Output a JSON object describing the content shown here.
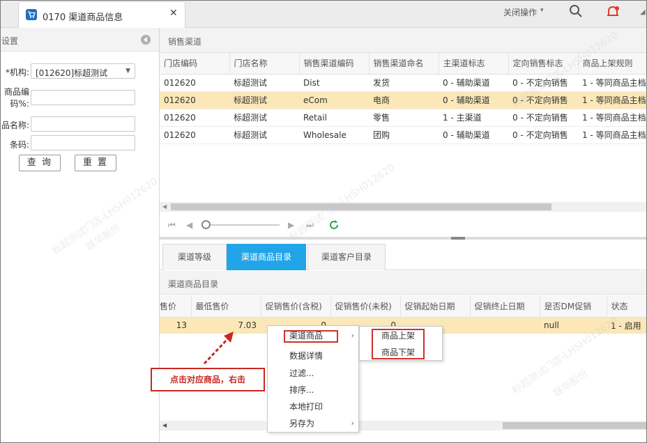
{
  "window": {
    "tab_title": "0170 渠道商品信息",
    "close_symbol": "✕",
    "close_ops_label": "关闭操作"
  },
  "left_panel": {
    "title": "设置",
    "org_label": "*机构:",
    "org_value": "[012620]标超测试",
    "code_label_1": "商品编",
    "code_label_2": "码%:",
    "name_label": "品名称:",
    "barcode_label": "条码:",
    "query_button": "查 询",
    "reset_button": "重 置"
  },
  "top_grid": {
    "title": "销售渠道",
    "columns": [
      "门店编码",
      "门店名称",
      "销售渠道编码",
      "销售渠道命名",
      "主渠道标志",
      "定向销售标志",
      "商品上架规则"
    ],
    "rows": [
      [
        "012620",
        "标超测试",
        "Dist",
        "发货",
        "0 - 辅助渠道",
        "0 - 不定向销售",
        "1 - 等同商品主档"
      ],
      [
        "012620",
        "标超测试",
        "eCom",
        "电商",
        "0 - 辅助渠道",
        "0 - 不定向销售",
        "1 - 等同商品主档"
      ],
      [
        "012620",
        "标超测试",
        "Retail",
        "零售",
        "1 - 主渠道",
        "0 - 不定向销售",
        "1 - 等同商品主档"
      ],
      [
        "012620",
        "标超测试",
        "Wholesale",
        "团购",
        "0 - 辅助渠道",
        "0 - 不定向销售",
        "1 - 等同商品主档"
      ]
    ],
    "selected_row": 1
  },
  "bottom_tabs": [
    "渠道等级",
    "渠道商品目录",
    "渠道客户目录"
  ],
  "active_bottom_tab": 1,
  "bottom_grid": {
    "title": "渠道商品目录",
    "columns": [
      "售价",
      "最低售价",
      "促销售价(含税)",
      "促销售价(未税)",
      "促销起始日期",
      "促销终止日期",
      "是否DM促销",
      "状态"
    ],
    "row": [
      "13",
      "7.03",
      "0",
      "0",
      "",
      "",
      "null",
      "1 - 启用"
    ]
  },
  "context_menu": {
    "items": [
      "渠道商品",
      "数据详情",
      "过滤...",
      "排序...",
      "本地打印",
      "另存为"
    ],
    "submenu": [
      "商品上架",
      "商品下架"
    ]
  },
  "annotation": {
    "text": "点击对应商品，右击"
  },
  "watermark": {
    "line1": "标超测试门店-LHSH012620",
    "line2": "联华股份"
  },
  "colors": {
    "accent_tab": "#21a5e8",
    "selected_row": "#fbe7b8",
    "annotation_red": "#c8281f"
  }
}
